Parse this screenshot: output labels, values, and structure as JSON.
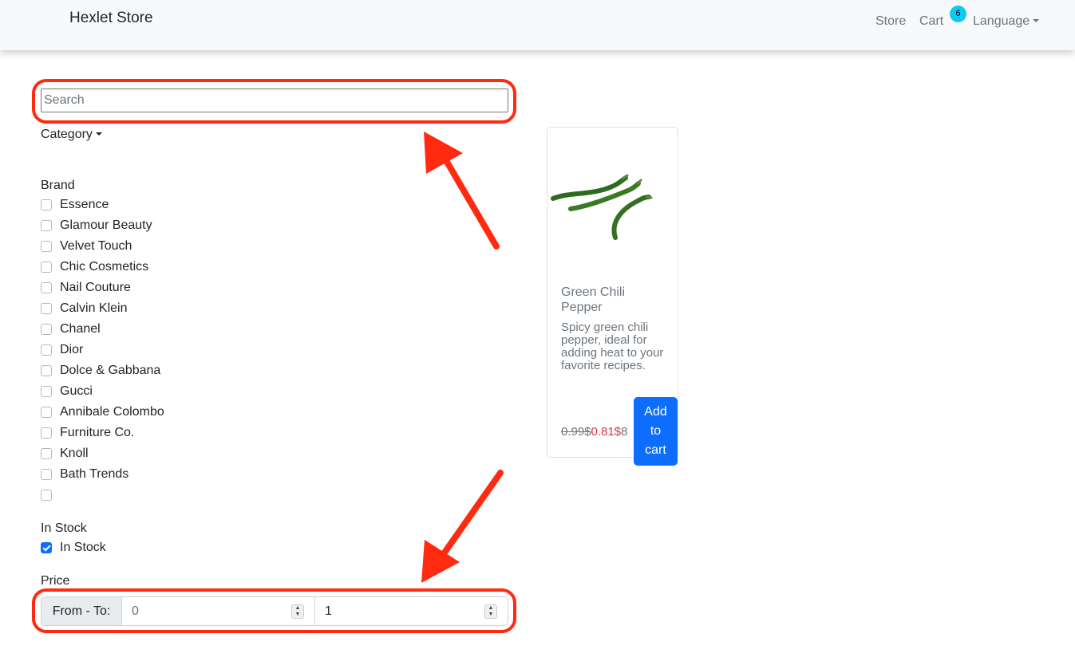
{
  "navbar": {
    "brand": "Hexlet Store",
    "links": {
      "store": "Store",
      "cart": "Cart",
      "language": "Language"
    },
    "cart_count": "6"
  },
  "filters": {
    "search_placeholder": "Search",
    "category_label": "Category",
    "brand_title": "Brand",
    "brands": [
      {
        "label": "Essence",
        "checked": false
      },
      {
        "label": "Glamour Beauty",
        "checked": false
      },
      {
        "label": "Velvet Touch",
        "checked": false
      },
      {
        "label": "Chic Cosmetics",
        "checked": false
      },
      {
        "label": "Nail Couture",
        "checked": false
      },
      {
        "label": "Calvin Klein",
        "checked": false
      },
      {
        "label": "Chanel",
        "checked": false
      },
      {
        "label": "Dior",
        "checked": false
      },
      {
        "label": "Dolce & Gabbana",
        "checked": false
      },
      {
        "label": "Gucci",
        "checked": false
      },
      {
        "label": "Annibale Colombo",
        "checked": false
      },
      {
        "label": "Furniture Co.",
        "checked": false
      },
      {
        "label": "Knoll",
        "checked": false
      },
      {
        "label": "Bath Trends",
        "checked": false
      },
      {
        "label": "",
        "checked": false
      }
    ],
    "stock_title": "In Stock",
    "stock_option": {
      "label": "In Stock",
      "checked": true
    },
    "price_title": "Price",
    "price_range_label": "From - To:",
    "price_from": "0",
    "price_to": "1"
  },
  "product": {
    "title": "Green Chili Pepper",
    "description": "Spicy green chili pepper, ideal for adding heat to your favorite recipes.",
    "old_price": "0.99$",
    "new_price": "0.81$",
    "qty_fragment": "8",
    "button_label": "Add to cart",
    "image": "green-chili-pepper"
  },
  "colors": {
    "primary": "#0d6efd",
    "badge": "#0dcaf0",
    "sale_price": "#dc3545",
    "annotation": "#ff2a10"
  }
}
